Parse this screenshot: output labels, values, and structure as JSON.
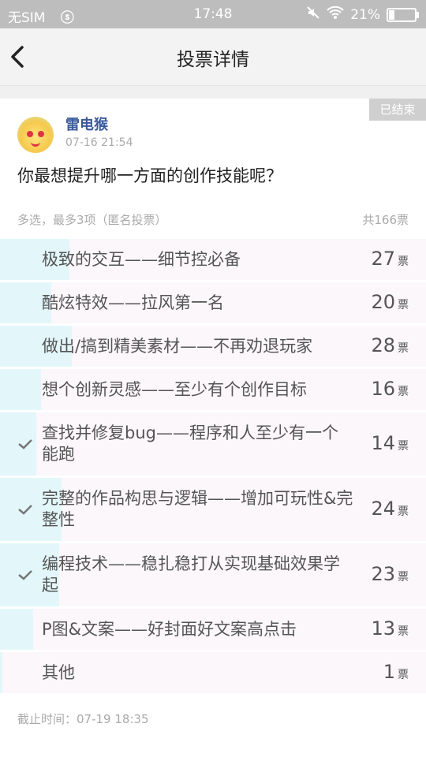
{
  "status_bar": {
    "carrier": "无SIM",
    "sim_icon": "ⓢ",
    "time": "17:48",
    "battery": "21%",
    "battery_level": 0.21,
    "icons": [
      "mute-icon",
      "wifi-icon",
      "battery-charging-icon"
    ]
  },
  "nav": {
    "title": "投票详情",
    "back_icon": "chevron-left-icon"
  },
  "post": {
    "ended_badge": "已结束",
    "username": "雷电猴",
    "time": "07-16 21:54",
    "question": "你最想提升哪一方面的创作技能呢？"
  },
  "vote": {
    "mode": "多选，最多3项（匿名投票）",
    "total": "共166票",
    "unit": "票",
    "options": [
      {
        "label": "极致的交互——细节控必备",
        "count": "27",
        "checked": false
      },
      {
        "label": "酷炫特效——拉风第一名",
        "count": "20",
        "checked": false
      },
      {
        "label": "做出/搞到精美素材——不再劝退玩家",
        "count": "28",
        "checked": false
      },
      {
        "label": "想个创新灵感——至少有个创作目标",
        "count": "16",
        "checked": false
      },
      {
        "label": "查找并修复bug——程序和人至少有一个能跑",
        "count": "14",
        "checked": true
      },
      {
        "label": "完整的作品构思与逻辑——增加可玩性&完整性",
        "count": "24",
        "checked": true
      },
      {
        "label": "编程技术——稳扎稳打从实现基础效果学起",
        "count": "23",
        "checked": true
      },
      {
        "label": "P图&文案——好封面好文案高点击",
        "count": "13",
        "checked": false
      },
      {
        "label": "其他",
        "count": "1",
        "checked": false
      }
    ],
    "deadline": "截止时间：07-19 18:35"
  },
  "colors": {
    "bar": "#e3f7fb",
    "row_bg": "#fbf7fb",
    "username": "#3a5a9a",
    "badge": "#cfcfcf"
  }
}
